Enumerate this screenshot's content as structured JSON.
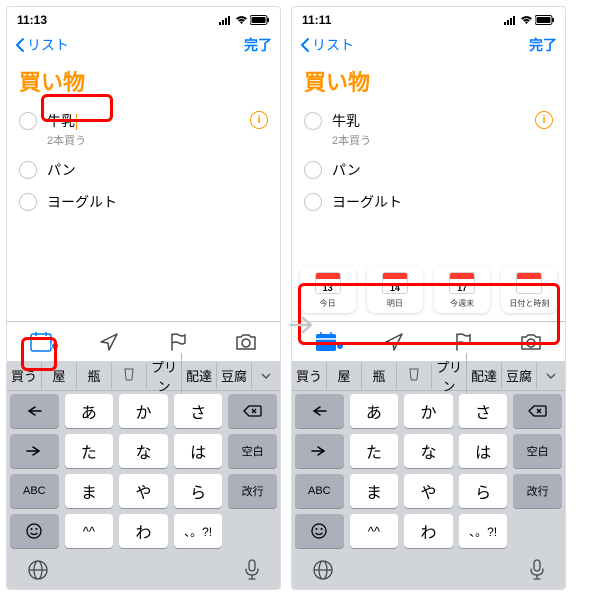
{
  "screens": {
    "left": {
      "time": "11:13",
      "back": "リスト",
      "done": "完了",
      "title": "買い物",
      "items": [
        {
          "title": "牛乳",
          "sub": "2本買う",
          "editing": true,
          "info": true
        },
        {
          "title": "パン"
        },
        {
          "title": "ヨーグルト"
        }
      ]
    },
    "right": {
      "time": "11:11",
      "back": "リスト",
      "done": "完了",
      "title": "買い物",
      "items": [
        {
          "title": "牛乳",
          "sub": "2本買う",
          "info": true
        },
        {
          "title": "パン"
        },
        {
          "title": "ヨーグルト"
        }
      ],
      "dates": [
        {
          "num": "13",
          "label": "今日"
        },
        {
          "num": "14",
          "label": "明日"
        },
        {
          "num": "17",
          "label": "今週末"
        },
        {
          "dots": "···",
          "label": "日付と時刻"
        }
      ]
    }
  },
  "keyboard": {
    "suggestions": [
      "買う",
      "屋",
      "瓶",
      "",
      "プリン",
      "配達",
      "豆腐"
    ],
    "rows": [
      [
        "",
        "あ",
        "か",
        "さ",
        ""
      ],
      [
        "",
        "た",
        "な",
        "は",
        "空白"
      ],
      [
        "ABC",
        "ま",
        "や",
        "ら",
        "改行"
      ],
      [
        "",
        "^^",
        "わ",
        "、。?!",
        ""
      ]
    ]
  }
}
